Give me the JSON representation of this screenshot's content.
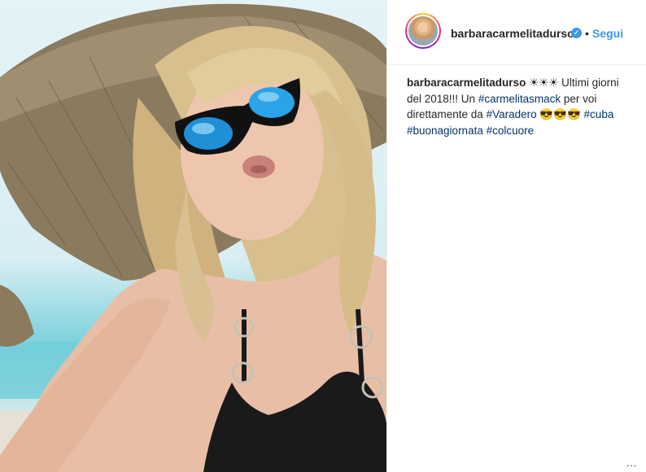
{
  "post": {
    "username": "barbaracarmelitadurso",
    "follow_label": "Segui",
    "dot": "•",
    "verified_glyph": "✓",
    "more_glyph": "...",
    "caption": {
      "username": "barbaracarmelitadurso",
      "part1": " ☀☀☀ Ultimi giorni del 2018!!! Un ",
      "tag1": "#carmelitasmack",
      "part2": " per voi direttamente da ",
      "tag2": "#Varadero",
      "part3": " 😎😎😎 ",
      "tag3": "#cuba",
      "tag4": "#buonagiornata",
      "tag5": "#colcuore"
    }
  },
  "icons": {
    "verified": "verified-badge-icon",
    "more": "more-options-icon"
  },
  "colors": {
    "link_blue": "#3897f0",
    "hashtag": "#003569",
    "text": "#262626",
    "divider": "#efefef"
  }
}
